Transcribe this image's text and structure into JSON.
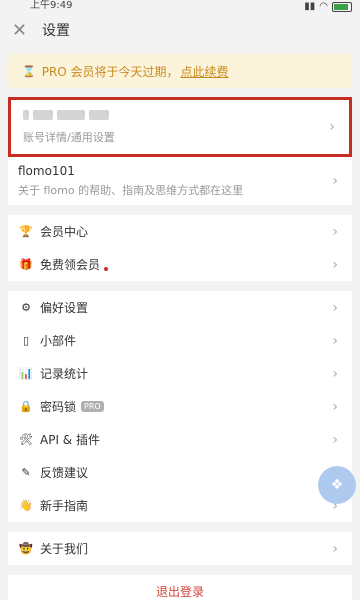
{
  "status_bar": {
    "time": "上午9:49"
  },
  "header": {
    "title": "设置"
  },
  "pro_banner": {
    "text": "PRO 会员将于今天过期，",
    "link": "点此续费"
  },
  "account": {
    "subtitle": "账号详情/通用设置"
  },
  "intro": {
    "name": "flomo101",
    "desc": "关于 flomo 的帮助、指南及思维方式都在这里"
  },
  "group1": [
    {
      "label": "会员中心"
    },
    {
      "label": "免费领会员"
    }
  ],
  "group2": [
    {
      "label": "偏好设置"
    },
    {
      "label": "小部件"
    },
    {
      "label": "记录统计"
    },
    {
      "label": "密码锁",
      "tag": "PRO"
    },
    {
      "label": "API & 插件"
    },
    {
      "label": "反馈建议"
    },
    {
      "label": "新手指南"
    }
  ],
  "group3": [
    {
      "label": "关于我们"
    }
  ],
  "logout": {
    "label": "退出登录"
  }
}
